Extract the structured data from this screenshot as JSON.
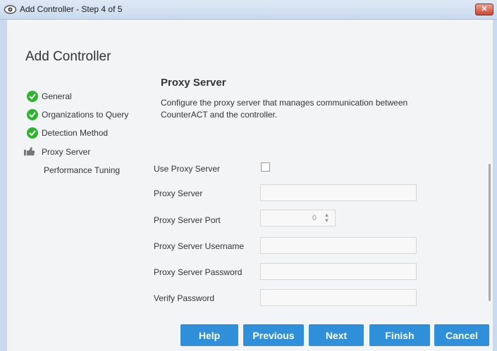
{
  "window": {
    "title": "Add Controller - Step 4 of 5",
    "app_icon": "eye-icon",
    "close_icon": "close-icon",
    "close_symbol": "✕"
  },
  "page": {
    "heading": "Add Controller"
  },
  "steps": [
    {
      "label": "General",
      "status": "complete",
      "icon": "check-circle-icon"
    },
    {
      "label": "Organizations to Query",
      "status": "complete",
      "icon": "check-circle-icon"
    },
    {
      "label": "Detection Method",
      "status": "complete",
      "icon": "check-circle-icon"
    },
    {
      "label": "Proxy Server",
      "status": "current",
      "icon": "pointing-hand-icon"
    },
    {
      "label": "Performance Tuning",
      "status": "pending",
      "icon": ""
    }
  ],
  "section": {
    "title": "Proxy Server",
    "description": "Configure the proxy server that manages communication between CounterACT and the controller."
  },
  "form": {
    "use_proxy_label": "Use Proxy Server",
    "use_proxy_checked": false,
    "proxy_server_label": "Proxy Server",
    "proxy_server_value": "",
    "proxy_port_label": "Proxy Server Port",
    "proxy_port_value": "0",
    "proxy_username_label": "Proxy Server Username",
    "proxy_username_value": "",
    "proxy_password_label": "Proxy Server Password",
    "proxy_password_value": "",
    "verify_password_label": "Verify Password",
    "verify_password_value": ""
  },
  "buttons": {
    "help": "Help",
    "previous": "Previous",
    "next": "Next",
    "finish": "Finish",
    "cancel": "Cancel"
  },
  "colors": {
    "button_blue": "#2f8fd8",
    "check_green": "#2db52d",
    "close_red": "#c7472f"
  }
}
